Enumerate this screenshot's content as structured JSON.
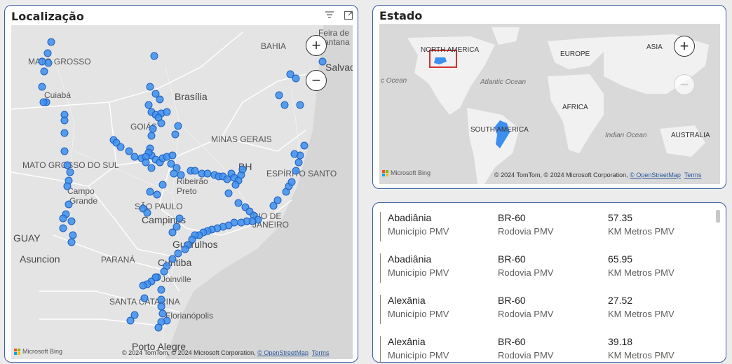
{
  "localizacao": {
    "title": "Localização",
    "labels": {
      "mato_grosso": "MATO GROSSO",
      "cuiaba": "Cuiabá",
      "bahia": "BAHIA",
      "feira1": "Feira de",
      "feira2": "Santana",
      "salvador": "Salvad",
      "brasilia": "Brasília",
      "goias": "GOIÁS",
      "minas": "MINAS GERAIS",
      "bh": "BH",
      "espirito": "ESPÍRITO SANTO",
      "ms": "MATO GROSSO DO SUL",
      "campo1": "Campo",
      "campo2": "Grande",
      "ribeirao1": "Ribeirão",
      "ribeirao2": "Preto",
      "sp": "SÃO PAULO",
      "campinas": "Campinas",
      "rio1": "RIO DE",
      "rio2": "JANEIRO",
      "guay": "GUAY",
      "asuncion": "Asuncion",
      "parana": "PARANÁ",
      "guarulhos": "Guarulhos",
      "curitiba": "Curitiba",
      "joinville": "Joinville",
      "sc": "SANTA CATARINA",
      "floripa": "Florianópolis",
      "poa": "Porto Alegre"
    },
    "zoom_in": "+",
    "zoom_out": "−",
    "bing": "Microsoft Bing",
    "attribution": "© 2024 TomTom, © 2024 Microsoft Corporation,",
    "osm": "© OpenStreetMap",
    "terms": "Terms",
    "point_color": "#3d8fef"
  },
  "estado": {
    "title": "Estado",
    "labels": {
      "north_america": "NORTH AMERICA",
      "europe": "EUROPE",
      "asia": "ASIA",
      "ocean_left": "c Ocean",
      "atlantic": "Atlantic Ocean",
      "africa": "AFRICA",
      "south_america": "SOUTH AMERICA",
      "indian": "Indian Ocean",
      "australia": "AUSTRALIA"
    },
    "zoom_in": "+",
    "zoom_out": "−",
    "bing": "Microsoft Bing",
    "attribution": "© 2024 TomTom, © 2024 Microsoft Corporation,",
    "osm": "© OpenStreetMap",
    "terms": "Terms",
    "fill_color": "#3d8fef"
  },
  "table": {
    "rows": [
      {
        "municipio": "Abadiânia",
        "municipio_label": "Município PMV",
        "rodovia": "BR-60",
        "rodovia_label": "Rodovia PMV",
        "km": "57.35",
        "km_label": "KM Metros PMV"
      },
      {
        "municipio": "Abadiânia",
        "municipio_label": "Município PMV",
        "rodovia": "BR-60",
        "rodovia_label": "Rodovia PMV",
        "km": "65.95",
        "km_label": "KM Metros PMV"
      },
      {
        "municipio": "Alexânia",
        "municipio_label": "Município PMV",
        "rodovia": "BR-60",
        "rodovia_label": "Rodovia PMV",
        "km": "27.52",
        "km_label": "KM Metros PMV"
      },
      {
        "municipio": "Alexânia",
        "municipio_label": "Município PMV",
        "rodovia": "BR-60",
        "rodovia_label": "Rodovia PMV",
        "km": "39.18",
        "km_label": "KM Metros PMV"
      }
    ]
  }
}
